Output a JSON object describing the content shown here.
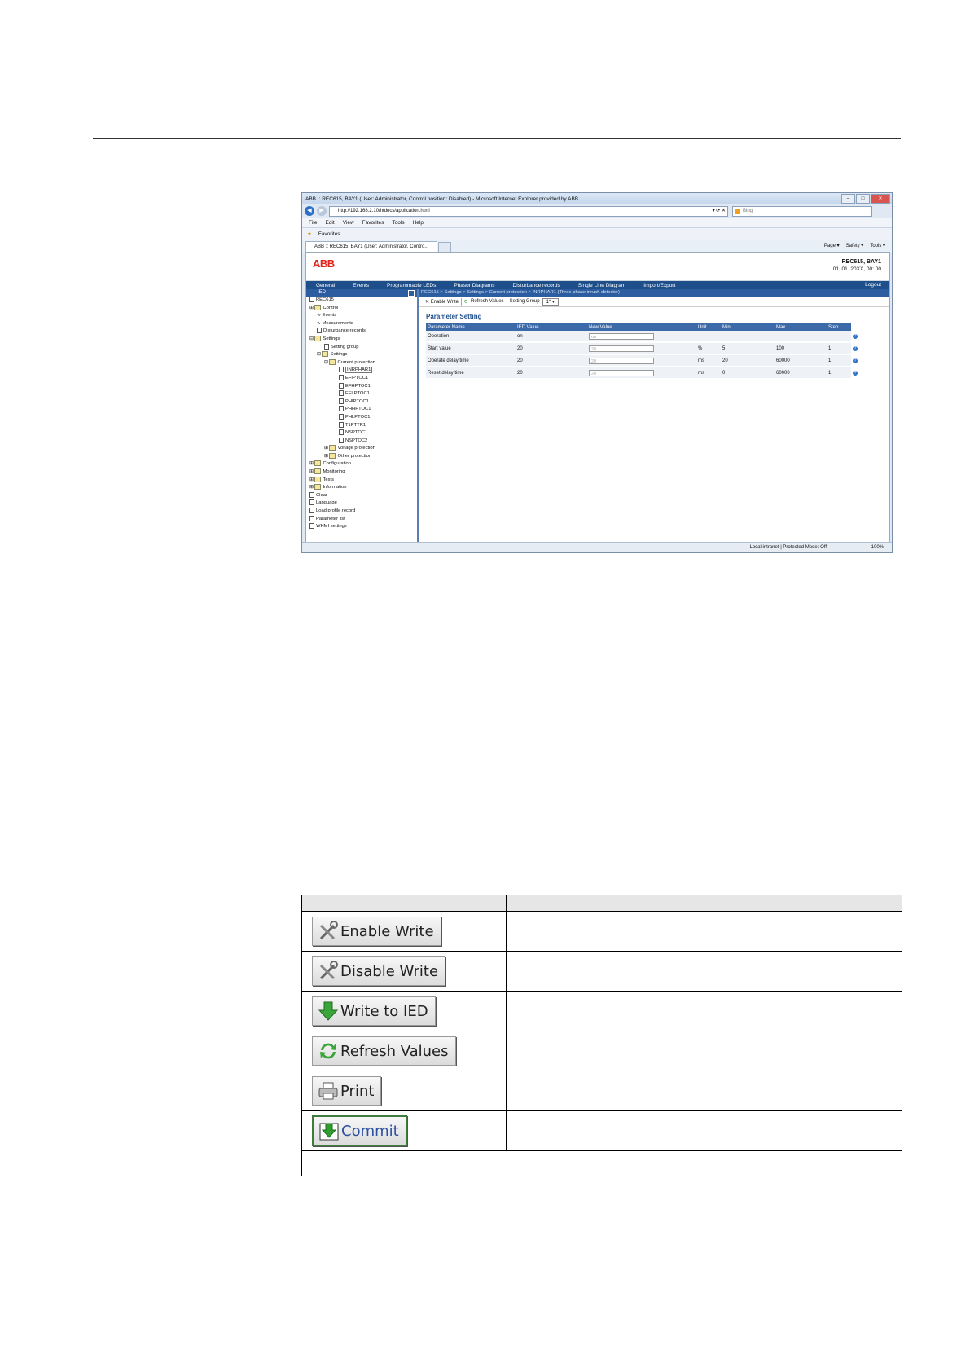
{
  "window_title": "ABB :: REC615, BAY1 (User: Administrator, Control position: Disabled) - Microsoft Internet Explorer provided by ABB",
  "address": "http://192.168.2.10/htdocs/application.html",
  "search_placeholder": "Bing",
  "menu": [
    "File",
    "Edit",
    "View",
    "Favorites",
    "Tools",
    "Help"
  ],
  "favorites_label": "Favorites",
  "tab_label": "ABB :: REC615, BAY1 (User: Administrator, Contro...",
  "command_bar": [
    "Page ▾",
    "Safety ▾",
    "Tools ▾"
  ],
  "brand": "ABB",
  "device": {
    "name": "REC615, BAY1",
    "datetime": "01. 01. 20XX, 00: 00"
  },
  "nav": [
    "General",
    "Events",
    "Programmable LEDs",
    "Phasor Diagrams",
    "Disturbance records",
    "Single Line Diagram",
    "Import/Export"
  ],
  "logout": "Logout",
  "left_header": "IED",
  "tree": [
    {
      "label": "REC615",
      "lvl": 0,
      "type": "doc"
    },
    {
      "label": "Control",
      "lvl": 0,
      "type": "folder",
      "exp": "⊞"
    },
    {
      "label": "Events",
      "lvl": 1,
      "type": "wave"
    },
    {
      "label": "Measurements",
      "lvl": 1,
      "type": "wave"
    },
    {
      "label": "Disturbance records",
      "lvl": 1,
      "type": "doc"
    },
    {
      "label": "Settings",
      "lvl": 0,
      "type": "folder",
      "exp": "⊟"
    },
    {
      "label": "Setting group",
      "lvl": 2,
      "type": "doc"
    },
    {
      "label": "Settings",
      "lvl": 1,
      "type": "folder",
      "exp": "⊟"
    },
    {
      "label": "Current protection",
      "lvl": 2,
      "type": "folder",
      "exp": "⊟"
    },
    {
      "label": "INRPHAR1",
      "lvl": 4,
      "type": "doc",
      "sel": true
    },
    {
      "label": "EFIPTOC1",
      "lvl": 4,
      "type": "doc"
    },
    {
      "label": "EFHPTOC1",
      "lvl": 4,
      "type": "doc"
    },
    {
      "label": "EFLPTOC1",
      "lvl": 4,
      "type": "doc"
    },
    {
      "label": "PHIPTOC1",
      "lvl": 4,
      "type": "doc"
    },
    {
      "label": "PHHPTOC1",
      "lvl": 4,
      "type": "doc"
    },
    {
      "label": "PHLPTOC1",
      "lvl": 4,
      "type": "doc"
    },
    {
      "label": "T1PTTR1",
      "lvl": 4,
      "type": "doc"
    },
    {
      "label": "NSPTOC1",
      "lvl": 4,
      "type": "doc"
    },
    {
      "label": "NSPTOC2",
      "lvl": 4,
      "type": "doc"
    },
    {
      "label": "Voltage protection",
      "lvl": 2,
      "type": "folder",
      "exp": "⊞"
    },
    {
      "label": "Other protection",
      "lvl": 2,
      "type": "folder",
      "exp": "⊞"
    },
    {
      "label": "Configuration",
      "lvl": 0,
      "type": "folder",
      "exp": "⊞"
    },
    {
      "label": "Monitoring",
      "lvl": 0,
      "type": "folder",
      "exp": "⊞"
    },
    {
      "label": "Tests",
      "lvl": 0,
      "type": "folder",
      "exp": "⊞"
    },
    {
      "label": "Information",
      "lvl": 0,
      "type": "folder",
      "exp": "⊞"
    },
    {
      "label": "Clear",
      "lvl": 0,
      "type": "doc"
    },
    {
      "label": "Language",
      "lvl": 0,
      "type": "doc"
    },
    {
      "label": "Load profile record",
      "lvl": 0,
      "type": "doc"
    },
    {
      "label": "Parameter list",
      "lvl": 0,
      "type": "doc"
    },
    {
      "label": "WHMI settings",
      "lvl": 0,
      "type": "doc"
    }
  ],
  "breadcrumb": "REC615 > Settings > Settings > Current protection > INRPHAR1 (Three phase inrush detector)",
  "toolbar": {
    "enable_write": "Enable Write",
    "refresh": "Refresh Values",
    "setting_group_label": "Setting Group",
    "setting_group_value": "1*"
  },
  "param_title": "Parameter Setting",
  "param_headers": [
    "Parameter Name",
    "IED Value",
    "New Value",
    "Unit",
    "Min.",
    "Max.",
    "Step"
  ],
  "params": [
    {
      "name": "Operation",
      "ied": "on",
      "new": "on",
      "unit": "",
      "min": "",
      "max": "",
      "step": ""
    },
    {
      "name": "Start value",
      "ied": "20",
      "new": "20",
      "unit": "%",
      "min": "5",
      "max": "100",
      "step": "1"
    },
    {
      "name": "Operate delay time",
      "ied": "20",
      "new": "20",
      "unit": "ms",
      "min": "20",
      "max": "60000",
      "step": "1"
    },
    {
      "name": "Reset delay time",
      "ied": "20",
      "new": "20",
      "unit": "ms",
      "min": "0",
      "max": "60000",
      "step": "1"
    }
  ],
  "status": {
    "zone": "Local intranet | Protected Mode: Off",
    "zoom": "100%"
  },
  "buttons": [
    {
      "label": "Enable Write",
      "icon": "tools-icon"
    },
    {
      "label": "Disable Write",
      "icon": "tools-icon"
    },
    {
      "label": "Write to IED",
      "icon": "green-down-arrow-icon"
    },
    {
      "label": "Refresh Values",
      "icon": "refresh-icon"
    },
    {
      "label": "Print",
      "icon": "printer-icon"
    },
    {
      "label": "Commit",
      "icon": "commit-icon"
    }
  ]
}
